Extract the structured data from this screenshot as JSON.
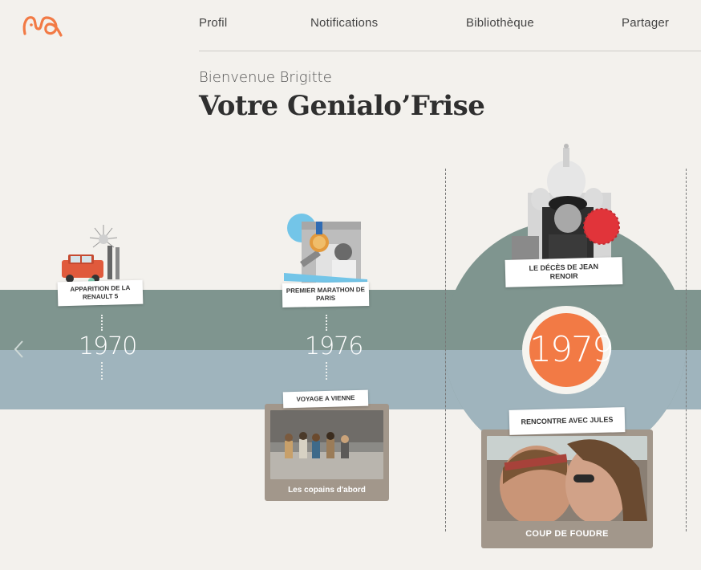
{
  "brand": {
    "logo_icon": "genialo-logo-icon",
    "accent": "#f27a45"
  },
  "nav": {
    "items": [
      {
        "label": "Profil"
      },
      {
        "label": "Notifications"
      },
      {
        "label": "Bibliothèque"
      },
      {
        "label": "Partager"
      }
    ]
  },
  "header": {
    "welcome": "Bienvenue Brigitte",
    "title": "Votre Genialo’Frise"
  },
  "timeline": {
    "prev_icon": "chevron-left-icon",
    "years": [
      {
        "year": "1970",
        "event_above": "APPARITION DE LA RENAULT 5"
      },
      {
        "year": "1976",
        "event_above": "PREMIER MARATHON DE PARIS",
        "event_below": "VOYAGE A VIENNE",
        "card_caption": "Les copains d'abord"
      },
      {
        "year": "1979",
        "event_above": "LE DÉCÈS DE JEAN RENOIR",
        "event_below": "RENCONTRE AVEC JULES",
        "card_caption": "COUP DE FOUDRE"
      }
    ]
  }
}
